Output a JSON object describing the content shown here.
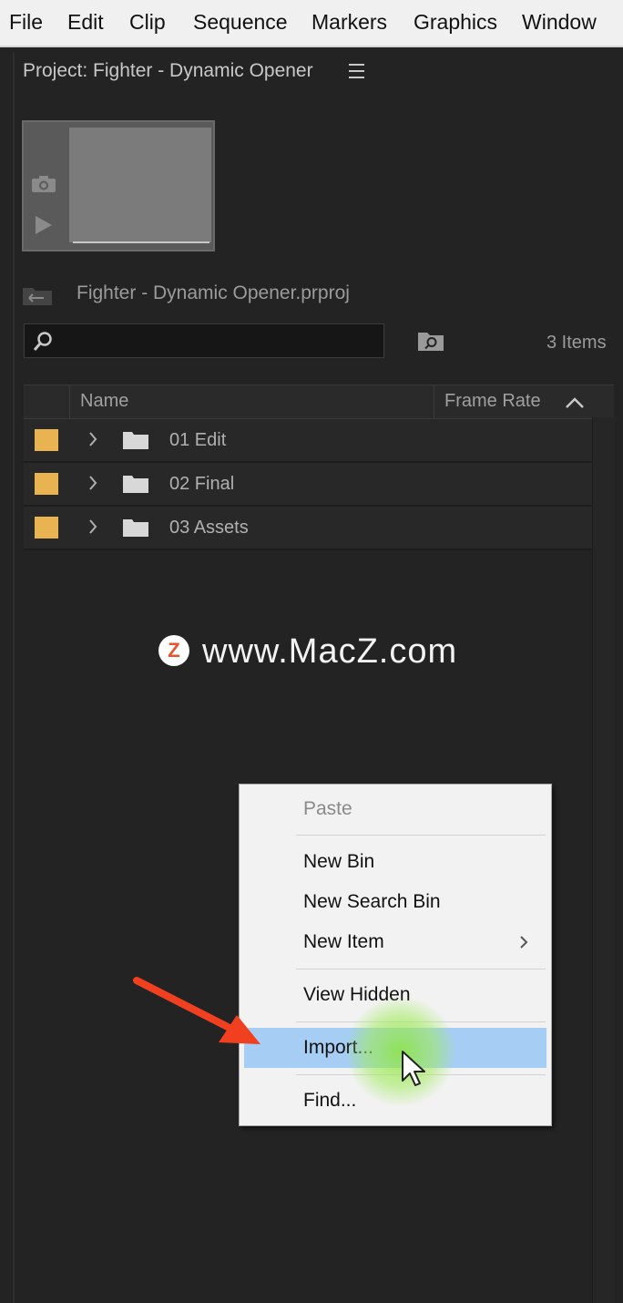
{
  "menubar": {
    "items": [
      "File",
      "Edit",
      "Clip",
      "Sequence",
      "Markers",
      "Graphics",
      "Window"
    ]
  },
  "panel": {
    "title": "Project: Fighter - Dynamic Opener",
    "file_name": "Fighter - Dynamic Opener.prproj",
    "search_placeholder": "",
    "items_count": "3 Items",
    "columns": {
      "name": "Name",
      "frame_rate": "Frame Rate"
    },
    "rows": [
      {
        "name": "01 Edit"
      },
      {
        "name": "02 Final"
      },
      {
        "name": "03 Assets"
      }
    ],
    "label_color": "#e8b350"
  },
  "watermark": {
    "logo": "Z",
    "text": "www.MacZ.com"
  },
  "context_menu": {
    "paste": "Paste",
    "new_bin": "New Bin",
    "new_search_bin": "New Search Bin",
    "new_item": "New Item",
    "view_hidden": "View Hidden",
    "import": "Import...",
    "find": "Find...",
    "highlight_color": "#a6cdf4"
  },
  "icons": [
    "camera-icon",
    "play-icon",
    "project-file-icon",
    "search-icon",
    "new-bin-icon",
    "sort-ascending-icon",
    "chevron-right-icon",
    "folder-icon",
    "mouse-cursor-icon",
    "red-arrow-icon"
  ]
}
